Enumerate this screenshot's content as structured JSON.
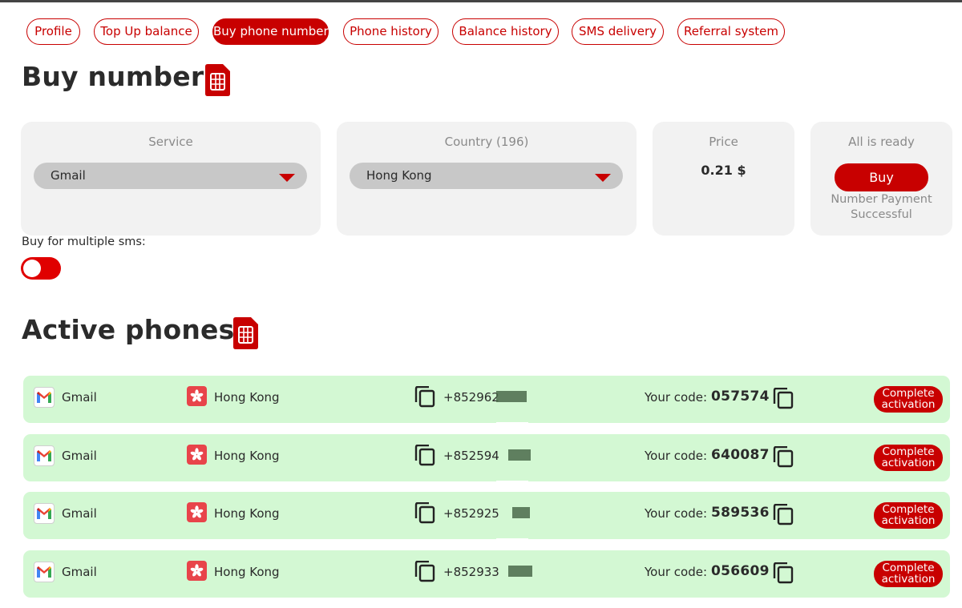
{
  "nav": {
    "items": [
      {
        "label": "Profile",
        "active": false
      },
      {
        "label": "Top Up balance",
        "active": false
      },
      {
        "label": "Buy phone number",
        "active": true
      },
      {
        "label": "Phone history",
        "active": false
      },
      {
        "label": "Balance history",
        "active": false
      },
      {
        "label": "SMS delivery",
        "active": false
      },
      {
        "label": "Referral system",
        "active": false
      }
    ]
  },
  "buy": {
    "title": "Buy number",
    "service": {
      "label": "Service",
      "value": "Gmail"
    },
    "country": {
      "label": "Country (196)",
      "value": "Hong Kong"
    },
    "price": {
      "label": "Price",
      "value": "0.21 $"
    },
    "ready": {
      "label": "All is ready",
      "button": "Buy",
      "status_line1": "Number Payment",
      "status_line2": "Successful"
    },
    "multiple_sms_label": "Buy for multiple sms:"
  },
  "active": {
    "title": "Active phones",
    "code_label": "Your code:",
    "complete_line1": "Complete",
    "complete_line2": "activation",
    "rows": [
      {
        "service": "Gmail",
        "country": "Hong Kong",
        "phone": "+852962",
        "code": "057574"
      },
      {
        "service": "Gmail",
        "country": "Hong Kong",
        "phone": "+852594",
        "code": "640087"
      },
      {
        "service": "Gmail",
        "country": "Hong Kong",
        "phone": "+852925",
        "code": "589536"
      },
      {
        "service": "Gmail",
        "country": "Hong Kong",
        "phone": "+852933",
        "code": "056609"
      }
    ]
  },
  "icons": {
    "sim": "sim-card-icon",
    "gmail": "gmail-icon",
    "flag": "hong-kong-flag-icon",
    "copy": "copy-icon",
    "caret": "caret-down-icon"
  },
  "colors": {
    "accent": "#c80000",
    "row_bg": "#d3f8d3",
    "card_bg": "#f2f2f2",
    "select_bg": "#c8c8c8"
  }
}
